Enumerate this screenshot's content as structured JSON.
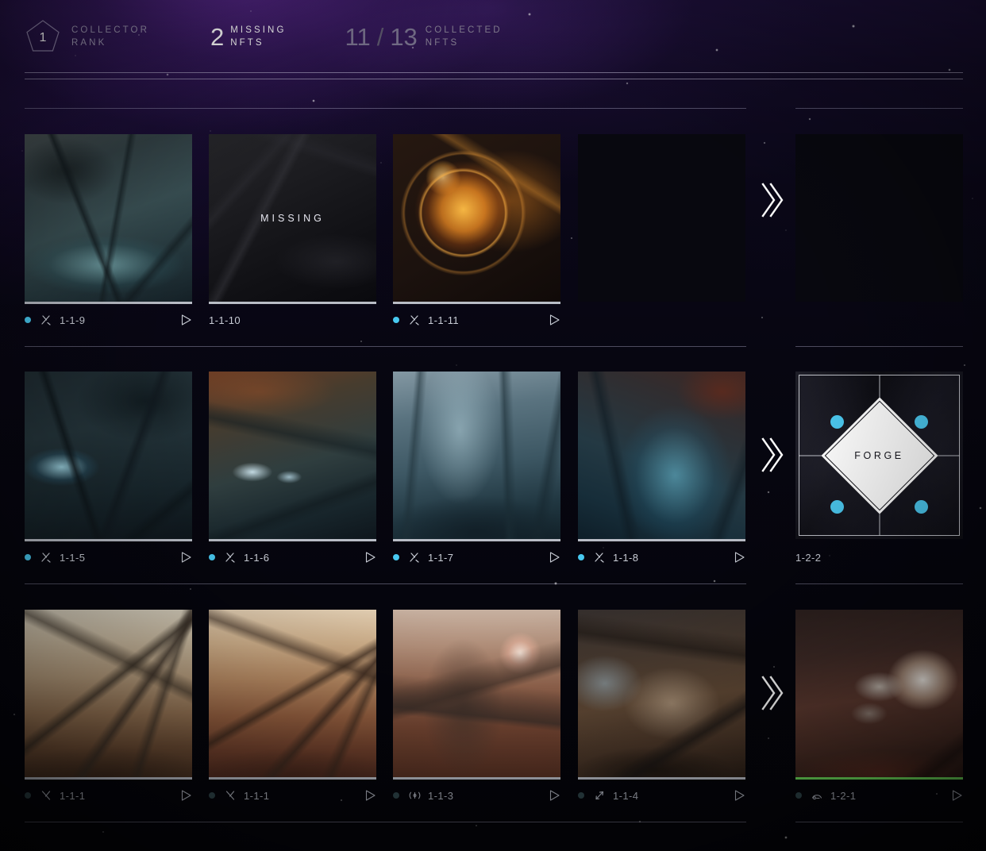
{
  "header": {
    "rank": {
      "value": "1",
      "label_line1": "COLLECTOR",
      "label_line2": "RANK"
    },
    "missing": {
      "value": "2",
      "label_line1": "MISSING",
      "label_line2": "NFTS"
    },
    "collected": {
      "owned": "11",
      "separator": "/",
      "total": "13",
      "label_line1": "COLLECTED",
      "label_line2": "NFTS"
    }
  },
  "colors": {
    "accent_cyan": "#48c9f0",
    "progress_green": "#6ddc5a",
    "underbar_default": "#b9bdc6",
    "rule": "#cdc8e1"
  },
  "rows": [
    {
      "cards": [
        {
          "id": "1-1-9",
          "state": "owned",
          "icon": "glyph-arrow-crossed-icon",
          "dot": "cyan",
          "underbar": "default",
          "play": true,
          "art": "art-1-1-9"
        },
        {
          "id": "1-1-10",
          "state": "missing",
          "icon": "none",
          "dot": "none",
          "underbar": "default",
          "play": false,
          "art": "art-1-1-10",
          "overlay_label": "MISSING"
        },
        {
          "id": "1-1-11",
          "state": "owned",
          "icon": "glyph-arrow-crossed-icon",
          "dot": "cyan",
          "underbar": "default",
          "play": true,
          "art": "art-1-1-11"
        },
        {
          "id": "",
          "state": "empty",
          "icon": "none",
          "dot": "none",
          "underbar": "none",
          "play": false,
          "art": ""
        }
      ],
      "chevron": true,
      "side": {
        "type": "empty-slot",
        "id": ""
      }
    },
    {
      "cards": [
        {
          "id": "1-1-5",
          "state": "owned",
          "icon": "glyph-arrow-crossed-icon",
          "dot": "cyan",
          "underbar": "default",
          "play": true,
          "art": "art-1-1-5"
        },
        {
          "id": "1-1-6",
          "state": "owned",
          "icon": "glyph-arrow-crossed-icon",
          "dot": "cyan",
          "underbar": "default",
          "play": true,
          "art": "art-1-1-6"
        },
        {
          "id": "1-1-7",
          "state": "owned",
          "icon": "glyph-arrow-crossed-icon",
          "dot": "cyan",
          "underbar": "default",
          "play": true,
          "art": "art-1-1-7"
        },
        {
          "id": "1-1-8",
          "state": "owned",
          "icon": "glyph-arrow-crossed-icon",
          "dot": "cyan",
          "underbar": "default",
          "play": true,
          "art": "art-1-1-8"
        }
      ],
      "chevron": true,
      "side": {
        "type": "forge",
        "id": "1-2-2",
        "label": "FORGE",
        "node_count": 4
      }
    },
    {
      "cards": [
        {
          "id": "1-1-1",
          "state": "owned",
          "icon": "glyph-scissors-icon",
          "dot": "dim",
          "underbar": "default",
          "play": true,
          "art": "art-1-1-1a"
        },
        {
          "id": "1-1-1",
          "state": "owned",
          "icon": "glyph-scissors-icon",
          "dot": "dim",
          "underbar": "default",
          "play": true,
          "art": "art-1-1-1b"
        },
        {
          "id": "1-1-3",
          "state": "owned",
          "icon": "glyph-antenna-icon",
          "dot": "dim",
          "underbar": "default",
          "play": true,
          "art": "art-1-1-3"
        },
        {
          "id": "1-1-4",
          "state": "owned",
          "icon": "glyph-bolt-icon",
          "dot": "dim",
          "underbar": "default",
          "play": true,
          "art": "art-1-1-4"
        }
      ],
      "chevron": true,
      "side": {
        "type": "card",
        "id": "1-2-1",
        "icon": "glyph-rover-icon",
        "dot": "teal",
        "underbar": "green",
        "play": true,
        "art": "art-1-2-1"
      }
    }
  ]
}
